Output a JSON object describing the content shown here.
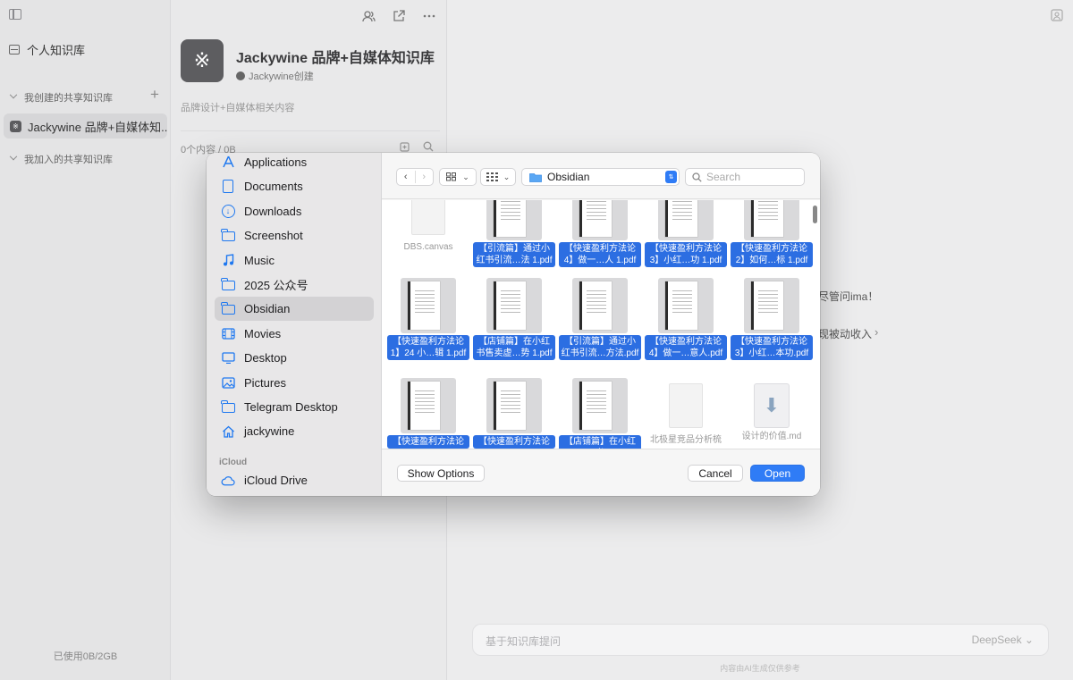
{
  "app": {
    "personal_kb": "个人知识库",
    "my_shared_header": "我创建的共享知识库",
    "joined_shared_header": "我加入的共享知识库",
    "kb_item_label": "Jackywine 品牌+自媒体知...",
    "kb_item_glyph": "※",
    "storage_usage": "已使用0B/2GB",
    "kb_title": "Jackywine 品牌+自媒体知识库",
    "kb_creator": "Jackywine创建",
    "kb_description": "品牌设计+自媒体相关内容",
    "kb_count": "0个内容 / 0B",
    "welcome_partial": "尽管问ima！",
    "passive_income_partial": "现被动收入",
    "ask_placeholder": "基于知识库提问",
    "model_selector": "DeepSeek ⌄",
    "footer_note": "内容由AI生成仅供参考"
  },
  "dialog": {
    "sidebar": {
      "favorites": [
        {
          "label": "Applications",
          "icon": "applications-icon"
        },
        {
          "label": "Documents",
          "icon": "document-icon"
        },
        {
          "label": "Downloads",
          "icon": "downloads-icon"
        },
        {
          "label": "Screenshot",
          "icon": "folder-icon"
        },
        {
          "label": "Music",
          "icon": "music-icon"
        },
        {
          "label": "2025 公众号",
          "icon": "folder-icon"
        },
        {
          "label": "Obsidian",
          "icon": "folder-icon",
          "selected": true
        },
        {
          "label": "Movies",
          "icon": "movies-icon"
        },
        {
          "label": "Desktop",
          "icon": "desktop-icon"
        },
        {
          "label": "Pictures",
          "icon": "pictures-icon"
        },
        {
          "label": "Telegram Desktop",
          "icon": "folder-icon"
        },
        {
          "label": "jackywine",
          "icon": "home-icon"
        }
      ],
      "icloud_header": "iCloud",
      "icloud_drive": "iCloud Drive"
    },
    "toolbar": {
      "current_folder": "Obsidian",
      "search_placeholder": "Search"
    },
    "files": [
      {
        "name": "DBS.canvas",
        "kind": "blank",
        "selected": false
      },
      {
        "name": "【引流篇】通过小红书引流…法 1.pdf",
        "kind": "pdf",
        "selected": true
      },
      {
        "name": "【快速盈利方法论4】做一…人 1.pdf",
        "kind": "pdf",
        "selected": true
      },
      {
        "name": "【快速盈利方法论3】小红…功 1.pdf",
        "kind": "pdf",
        "selected": true
      },
      {
        "name": "【快速盈利方法论2】如何…标 1.pdf",
        "kind": "pdf",
        "selected": true
      },
      {
        "name": "【快速盈利方法论1】24 小…辑 1.pdf",
        "kind": "pdf",
        "selected": true
      },
      {
        "name": "【店铺篇】在小红书售卖虚…势 1.pdf",
        "kind": "pdf",
        "selected": true
      },
      {
        "name": "【引流篇】通过小红书引流…方法.pdf",
        "kind": "pdf",
        "selected": true
      },
      {
        "name": "【快速盈利方法论4】做一…意人.pdf",
        "kind": "pdf",
        "selected": true
      },
      {
        "name": "【快速盈利方法论3】小红…本功.pdf",
        "kind": "pdf",
        "selected": true
      },
      {
        "name": "【快速盈利方法论",
        "kind": "pdf",
        "selected": true
      },
      {
        "name": "【快速盈利方法论",
        "kind": "pdf",
        "selected": true
      },
      {
        "name": "【店铺篇】在小红书",
        "kind": "pdf",
        "selected": true
      },
      {
        "name": "北极星竞品分析梳",
        "kind": "blank",
        "selected": false
      },
      {
        "name": "设计的价值.md",
        "kind": "md",
        "selected": false
      }
    ],
    "footer": {
      "show_options": "Show Options",
      "cancel": "Cancel",
      "open": "Open"
    }
  },
  "colors": {
    "accent": "#2f7cf6",
    "selection": "#2c6ee2",
    "sidebar_bg": "#e8e7e8"
  }
}
